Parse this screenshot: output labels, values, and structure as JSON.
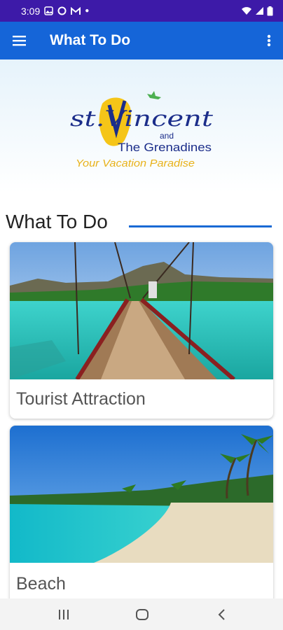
{
  "status_bar": {
    "time": "3:09",
    "icons": [
      "image-icon",
      "circle-icon",
      "mail-icon",
      "dot-icon",
      "wifi-icon",
      "signal-icon",
      "battery-icon"
    ]
  },
  "app_bar": {
    "title": "What To Do",
    "menu_icon": "hamburger-menu-icon",
    "overflow_icon": "more-vert-icon"
  },
  "logo": {
    "brand_line_1": "st.Vincent",
    "brand_and": "and",
    "brand_line_2": "The Grenadines",
    "tagline": "Your Vacation Paradise"
  },
  "section": {
    "title": "What To Do"
  },
  "cards": [
    {
      "label": "Tourist Attraction",
      "image": "suspension-bridge-over-turquoise-water"
    },
    {
      "label": "Beach",
      "image": "palm-tree-beach-turquoise-sea"
    }
  ],
  "nav_bar": {
    "icons": [
      "recent-apps-icon",
      "home-icon",
      "back-icon"
    ]
  },
  "colors": {
    "status_bar": "#3d1aa8",
    "app_bar": "#1565d8",
    "accent_rule": "#1a6ad4",
    "tagline": "#e8b21a",
    "logo_text": "#1b2d8a"
  }
}
